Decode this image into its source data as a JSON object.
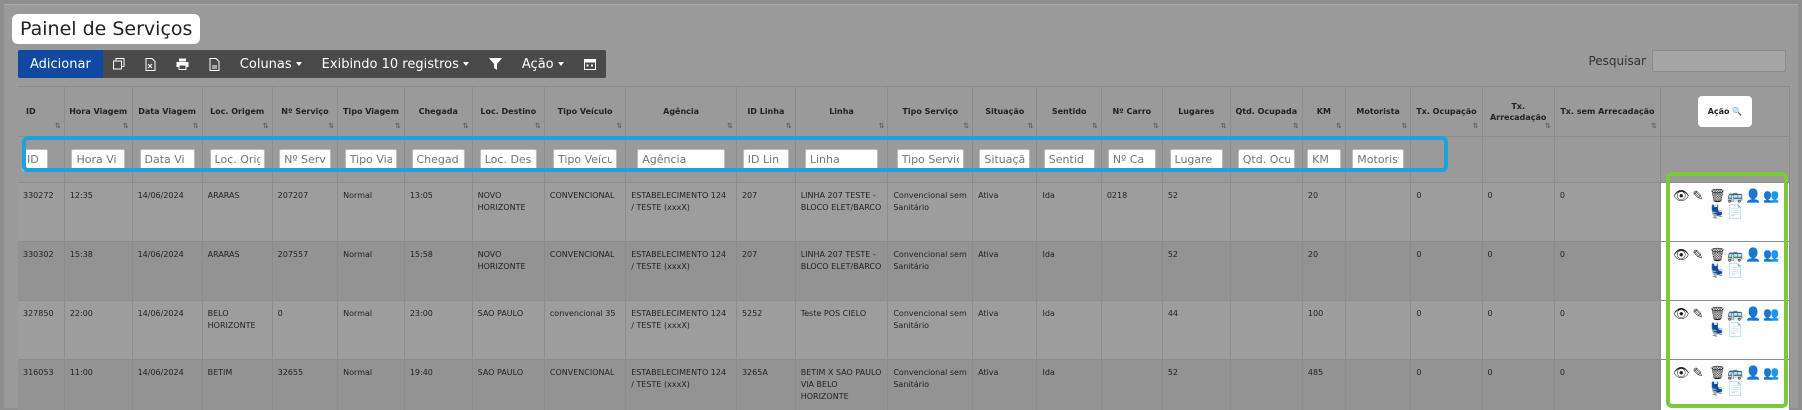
{
  "page": {
    "title": "Painel de Serviços"
  },
  "toolbar": {
    "add_label": "Adicionar",
    "columns_label": "Colunas",
    "showing_label": "Exibindo 10 registros",
    "action_label": "Ação"
  },
  "search": {
    "label": "Pesquisar",
    "value": ""
  },
  "table": {
    "headers": [
      "ID",
      "Hora Viagem",
      "Data Viagem",
      "Loc. Origem",
      "Nº Serviço",
      "Tipo Viagem",
      "Chegada",
      "Loc. Destino",
      "Tipo Veículo",
      "Agência",
      "ID Linha",
      "Linha",
      "Tipo Serviço",
      "Situação",
      "Sentido",
      "Nº Carro",
      "Lugares",
      "Qtd. Ocupada",
      "KM",
      "Motorista",
      "Tx. Ocupação",
      "Tx. Arrecadação",
      "Tx. sem Arrecadação",
      "Ação"
    ],
    "filter_placeholders": [
      "ID",
      "Hora Vi",
      "Data Vi",
      "Loc. Orig",
      "Nº Serv",
      "Tipo Via",
      "Chegad",
      "Loc. Des",
      "Tipo Veícu",
      "Agência",
      "ID Lin",
      "Linha",
      "Tipo Serviç",
      "Situaçã",
      "Sentid",
      "Nº Ca",
      "Lugare",
      "Qtd. Ocu",
      "KM",
      "Motorist"
    ],
    "rows": [
      [
        "330272",
        "12:35",
        "14/06/2024",
        "ARARAS",
        "207207",
        "Normal",
        "13:05",
        "NOVO HORIZONTE",
        "CONVENCIONAL",
        "ESTABELECIMENTO 124 / TESTE (xxxX)",
        "207",
        "LINHA 207 TESTE - BLOCO ELET/BARCO",
        "Convencional sem Sanitário",
        "Ativa",
        "Ida",
        "0218",
        "52",
        "",
        "20",
        "",
        "0",
        "0",
        "0"
      ],
      [
        "330302",
        "15:38",
        "14/06/2024",
        "ARARAS",
        "207557",
        "Normal",
        "15:58",
        "NOVO HORIZONTE",
        "CONVENCIONAL",
        "ESTABELECIMENTO 124 / TESTE (xxxX)",
        "207",
        "LINHA 207 TESTE - BLOCO ELET/BARCO",
        "Convencional sem Sanitário",
        "Ativa",
        "Ida",
        "",
        "52",
        "",
        "20",
        "",
        "0",
        "0",
        "0"
      ],
      [
        "327850",
        "22:00",
        "14/06/2024",
        "BELO HORIZONTE",
        "0",
        "Normal",
        "23:00",
        "SAO PAULO",
        "convencional 35",
        "ESTABELECIMENTO 124 / TESTE (xxxX)",
        "5252",
        "Teste POS CIELO",
        "Convencional sem Sanitário",
        "Ativa",
        "Ida",
        "",
        "44",
        "",
        "100",
        "",
        "0",
        "0",
        "0"
      ],
      [
        "316053",
        "11:00",
        "14/06/2024",
        "BETIM",
        "32655",
        "Normal",
        "19:40",
        "SAO PAULO",
        "CONVENCIONAL",
        "ESTABELECIMENTO 124 / TESTE (xxxX)",
        "3265A",
        "BETIM X SAO PAULO VIA BELO HORIZONTE",
        "Convencional sem Sanitário",
        "Ativa",
        "Ida",
        "",
        "52",
        "",
        "485",
        "",
        "0",
        "0",
        "0"
      ]
    ]
  },
  "icons": {
    "action_row1": [
      "view-icon",
      "edit-icon",
      "delete-icon",
      "bus-icon",
      "add-user-icon",
      "users-icon"
    ],
    "action_row2": [
      "seat-icon",
      "document-icon"
    ]
  },
  "colors": {
    "primary": "#0f4aa0",
    "highlight_blue": "#1aa3e0",
    "highlight_green": "#7cc93a"
  }
}
